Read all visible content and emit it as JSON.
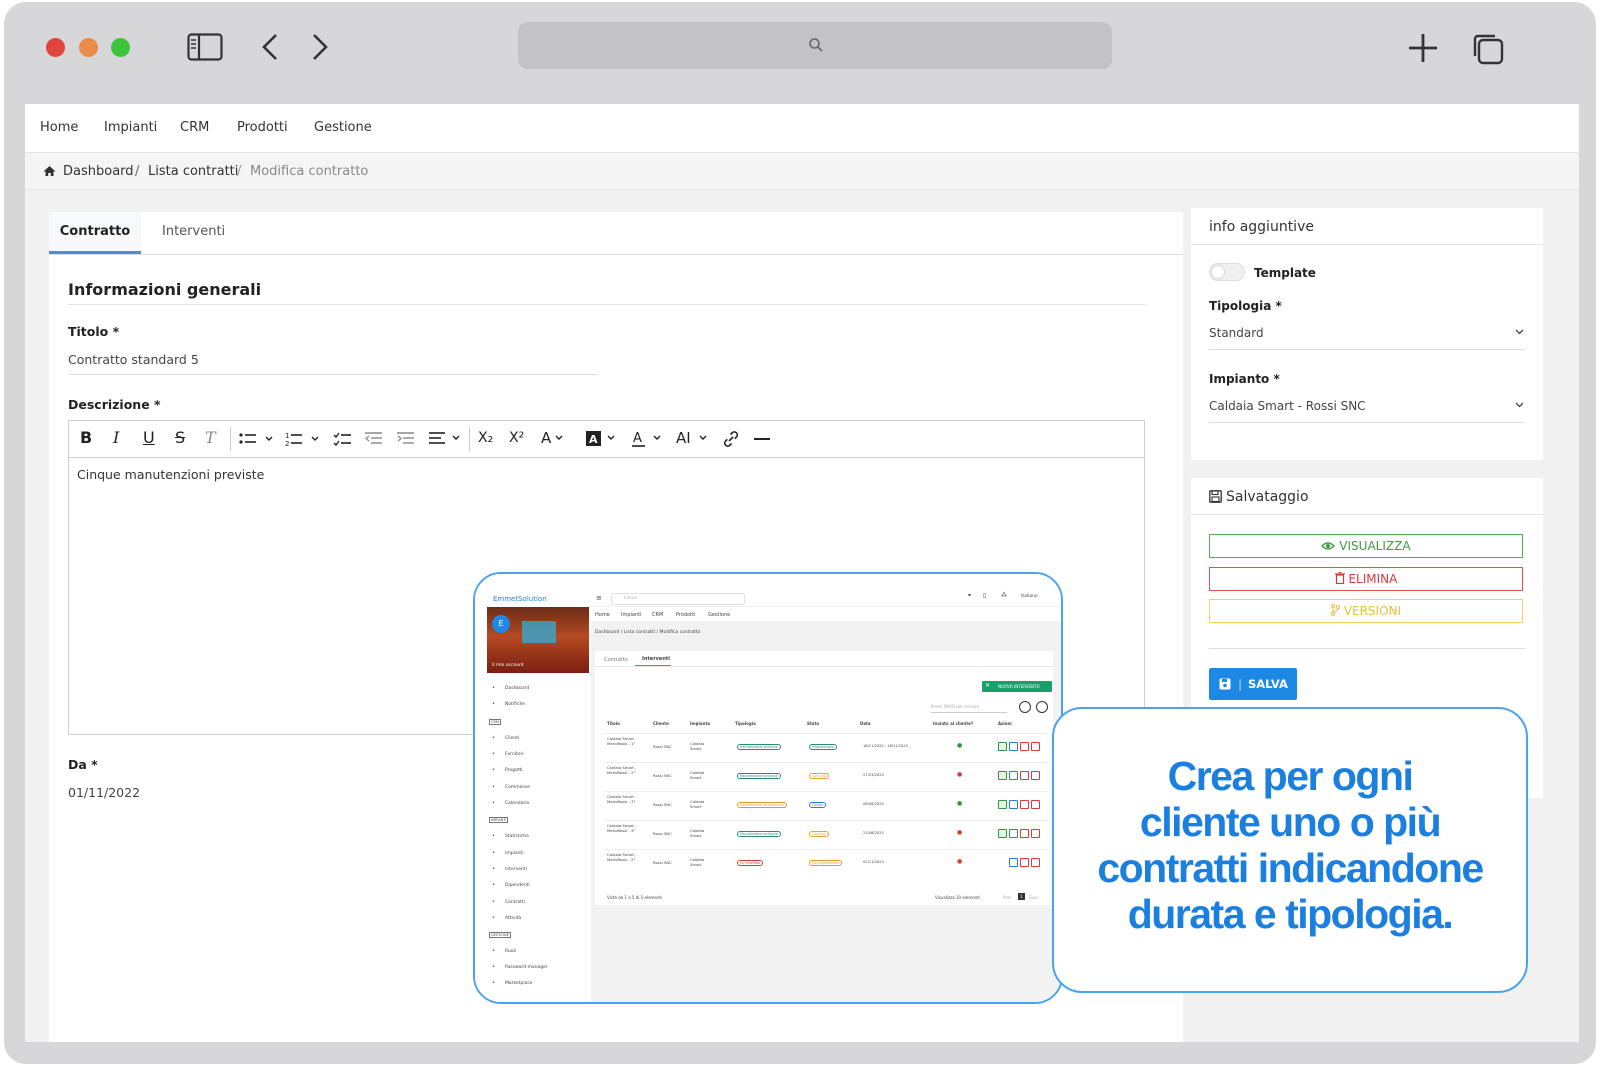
{
  "topnav": [
    "Home",
    "Impianti",
    "CRM",
    "Prodotti",
    "Gestione"
  ],
  "breadcrumb": [
    "Dashboard",
    "/",
    "Lista contratti",
    "/",
    "Modifica contratto"
  ],
  "tabs": {
    "contratto": "Contratto",
    "interventi": "Interventi"
  },
  "form": {
    "section_title": "Informazioni generali",
    "titolo_label": "Titolo *",
    "titolo_value": "Contratto standard 5",
    "descrizione_label": "Descrizione *",
    "descrizione_value": "Cinque manutenzioni previste",
    "da_label": "Da *",
    "da_value": "01/11/2022"
  },
  "toolbar": {
    "bold": "B",
    "italic": "I",
    "underline": "U",
    "strike": "S",
    "clear": "T",
    "subscript": "X₂",
    "superscript": "X²",
    "font_size": "AI",
    "heading": "A"
  },
  "side_info": {
    "title": "info aggiuntive",
    "template_label": "Template",
    "tipologia_label": "Tipologia *",
    "tipologia_value": "Standard",
    "impianto_label": "Impianto *",
    "impianto_value": "Caldaia Smart - Rossi SNC"
  },
  "side_save": {
    "title": "Salvataggio",
    "visualizza": "VISUALIZZA",
    "elimina": "ELIMINA",
    "versioni": "VERSIONI",
    "salva": "SALVA"
  },
  "callout": [
    "Crea per ogni",
    "cliente uno o più",
    "contratti indicandone",
    "durata e tipologia."
  ],
  "mini": {
    "brand": "EmmetSolution",
    "search_placeholder": "Cerca",
    "language": "Italiano",
    "account": "Il mio account",
    "avatar_letter": "E",
    "menu": [
      "Dashboard",
      "Notifiche",
      "CRM",
      "Clienti",
      "Fornitori",
      "Progetti",
      "Commesse",
      "Calendario",
      "IMPIANTI",
      "Statistiche",
      "Impianti",
      "Interventi",
      "Dipendenti",
      "Contratti",
      "Attività",
      "GESTIONE",
      "Ruoli",
      "Password manager",
      "Marketplace"
    ],
    "topnav": [
      "Home",
      "Impianti",
      "CRM",
      "Prodotti",
      "Gestione"
    ],
    "breadcrumb": "Dashboard / Lista contratti / Modifica contratto",
    "tabs": [
      "Contratto",
      "Interventi"
    ],
    "new_button": "NUOVO INTERVENTO",
    "search_hint": "Premi INVIO per cercare",
    "columns": [
      "Titolo",
      "Cliente",
      "Impianto",
      "Tipologia",
      "Stato",
      "Data",
      "Inviato al cliente?",
      "Azioni"
    ],
    "rows": [
      {
        "titolo": "Caldaia Smart - MarioRossi - 1°",
        "cliente": "Rossi SNC",
        "impianto": "Caldaia Smart",
        "tipologia": "Manutenzione ordinaria",
        "stato": "Programmato",
        "data": "18/11/2022 - 18/11/2022",
        "inviato": "yes"
      },
      {
        "titolo": "Caldaia Smart - MarioRossi - 2°",
        "cliente": "Rossi SNC",
        "impianto": "Caldaia Smart",
        "tipologia": "Manutenzione ordinaria",
        "stato": "Concluso",
        "data": "27/03/2023",
        "inviato": "no"
      },
      {
        "titolo": "Caldaia Smart - MarioRossi - 3°",
        "cliente": "Rossi SNC",
        "impianto": "Caldaia Smart",
        "tipologia": "Manutenzione straordinaria",
        "stato": "Chiuso",
        "data": "08/06/2023",
        "inviato": "yes"
      },
      {
        "titolo": "Caldaia Smart - MarioRossi - 4°",
        "cliente": "Rossi SNC",
        "impianto": "Caldaia Smart",
        "tipologia": "Manutenzione ordinaria",
        "stato": "Concluso",
        "data": "21/08/2023",
        "inviato": "no"
      },
      {
        "titolo": "Caldaia Smart - MarioRossi - 5°",
        "cliente": "Rossi SNC",
        "impianto": "Caldaia Smart",
        "tipologia": "Su chiamata",
        "stato": "Da programmare",
        "data": "02/11/2023",
        "inviato": "no"
      }
    ],
    "footer_left": "Vista da 1 a 5 di 5 elementi",
    "footer_right": "Visualizza 10 elementi",
    "prev": "Prec",
    "page": "1",
    "next": "Succ"
  },
  "colors": {
    "accent_blue": "#1e88e5",
    "callout_blue": "#1b7fe0",
    "green": "#4caf50",
    "red": "#e05252",
    "yellow": "#f2d264",
    "mini_green": "#18a06b"
  }
}
